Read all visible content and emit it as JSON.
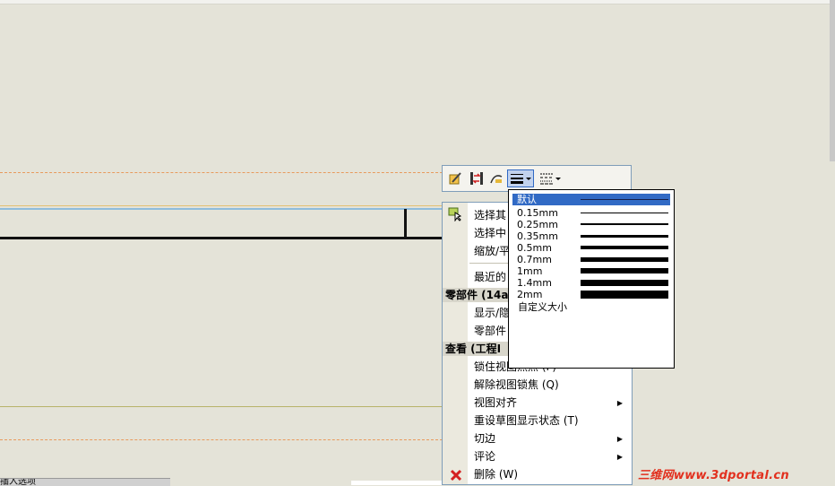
{
  "toolbar": {
    "icons": [
      "edit-sketch-icon",
      "swap-icon",
      "smart-dimension-icon",
      "line-weight-icon",
      "line-style-icon"
    ]
  },
  "context_menu": {
    "items_top": [
      {
        "label": "选择其"
      },
      {
        "label": "选择中"
      },
      {
        "label": "缩放/平"
      },
      {
        "label": "最近的"
      }
    ],
    "section1": "零部件  (14a",
    "items_mid": [
      {
        "label": "显示/隐"
      },
      {
        "label": "零部件"
      }
    ],
    "section2": "查看  (工程I",
    "items_bottom": [
      {
        "label": "锁住视图焦点  (F)"
      },
      {
        "label": "解除视图锁焦  (Q)"
      },
      {
        "label": "视图对齐",
        "submenu": true
      },
      {
        "label": "重设草图显示状态  (T)"
      },
      {
        "label": "切边",
        "submenu": true
      },
      {
        "label": "评论",
        "submenu": true
      },
      {
        "label": "删除  (W)"
      }
    ]
  },
  "line_weight_dropdown": {
    "options": [
      {
        "label": "默认",
        "weight": 1,
        "selected": true
      },
      {
        "label": "0.15mm",
        "weight": 1
      },
      {
        "label": "0.25mm",
        "weight": 2
      },
      {
        "label": "0.35mm",
        "weight": 3
      },
      {
        "label": "0.5mm",
        "weight": 4
      },
      {
        "label": "0.7mm",
        "weight": 5
      },
      {
        "label": "1mm",
        "weight": 6
      },
      {
        "label": "1.4mm",
        "weight": 7
      },
      {
        "label": "2mm",
        "weight": 9
      }
    ],
    "custom_label": "自定义大小"
  },
  "watermark": "三维网www.3dportal.cn",
  "bottom_panel_label": "插入选项"
}
